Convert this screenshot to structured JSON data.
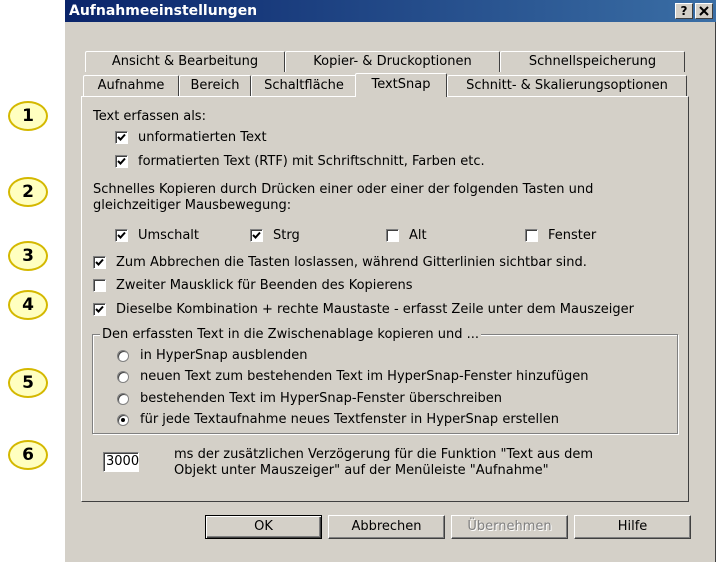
{
  "window": {
    "title": "Aufnahmeeinstellungen",
    "help_btn": "?",
    "close_btn": "✕"
  },
  "tabs_row1": [
    "Ansicht & Bearbeitung",
    "Kopier- & Druckoptionen",
    "Schnellspeicherung"
  ],
  "tabs_row2": [
    "Aufnahme",
    "Bereich",
    "Schaltfläche",
    "TextSnap",
    "Schnitt- & Skalierungsoptionen"
  ],
  "active_tab": "TextSnap",
  "callouts": [
    "1",
    "2",
    "3",
    "4",
    "5",
    "6"
  ],
  "section1": {
    "label": "Text erfassen als:",
    "opt_plain": {
      "label": "unformatierten Text",
      "checked": true
    },
    "opt_rtf": {
      "label": "formatierten Text (RTF) mit Schriftschnitt, Farben etc.",
      "checked": true
    }
  },
  "section2": {
    "label_line1": "Schnelles Kopieren durch Drücken einer oder einer der folgenden Tasten und",
    "label_line2": "gleichzeitiger Mausbewegung:",
    "keys": [
      {
        "label": "Umschalt",
        "checked": true
      },
      {
        "label": "Strg",
        "checked": true
      },
      {
        "label": "Alt",
        "checked": false
      },
      {
        "label": "Fenster",
        "checked": false
      }
    ]
  },
  "opt3": {
    "label": "Zum Abbrechen die Tasten loslassen, während Gitterlinien sichtbar sind.",
    "checked": true
  },
  "opt3b": {
    "label": "Zweiter Mausklick für Beenden des Kopierens",
    "checked": false
  },
  "opt4": {
    "label": "Dieselbe Kombination + rechte Maustaste - erfasst Zeile unter dem Mauszeiger",
    "checked": true
  },
  "group5": {
    "label": "Den erfassten Text in die Zwischenablage kopieren und ...",
    "options": [
      {
        "label": "in HyperSnap ausblenden",
        "selected": false
      },
      {
        "label": "neuen Text zum bestehenden Text im HyperSnap-Fenster hinzufügen",
        "selected": false
      },
      {
        "label": "bestehenden Text im HyperSnap-Fenster überschreiben",
        "selected": false
      },
      {
        "label": "für jede Textaufnahme neues Textfenster in HyperSnap erstellen",
        "selected": true
      }
    ]
  },
  "delay": {
    "value": "3000",
    "line1": "ms der zusätzlichen Verzögerung für die Funktion \"Text aus dem",
    "line2": "Objekt unter Mauszeiger\" auf der Menüleiste \"Aufnahme\""
  },
  "buttons": {
    "ok": "OK",
    "cancel": "Abbrechen",
    "apply": "Übernehmen",
    "help": "Hilfe"
  }
}
